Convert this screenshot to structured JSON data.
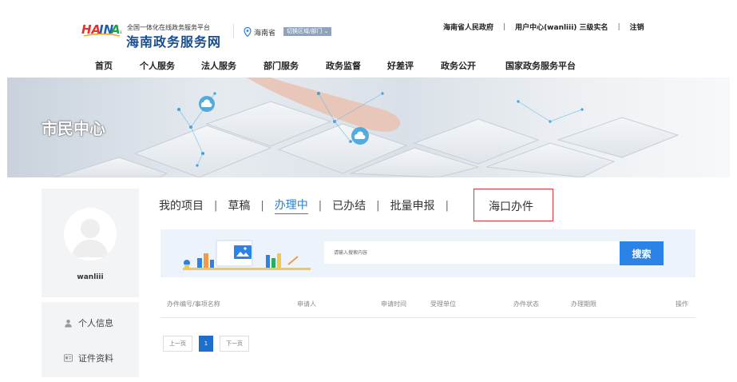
{
  "header": {
    "logo_text": "HAINAN",
    "platform_sub": "全国一体化在线政务服务平台",
    "site_title": "海南政务服务网",
    "location": "海南省",
    "region_select": "切换区域/部门",
    "top_links": [
      "海南省人民政府",
      "用户中心(wanliii) 三级实名",
      "注销"
    ]
  },
  "nav": [
    "首页",
    "个人服务",
    "法人服务",
    "部门服务",
    "政务监督",
    "好差评",
    "政务公开",
    "国家政务服务平台"
  ],
  "banner": {
    "title": "市民中心"
  },
  "sidebar": {
    "username": "wanliii",
    "menu": [
      "个人信息",
      "证件资料"
    ]
  },
  "tabs": [
    "我的项目",
    "草稿",
    "办理中",
    "已办结",
    "批量申报"
  ],
  "active_tab": "办理中",
  "highlighted_tab": "海口办件",
  "search": {
    "placeholder": "请输入搜索内容",
    "button": "搜索"
  },
  "table": {
    "columns": [
      "办件编号/事项名称",
      "申请人",
      "申请时间",
      "受理单位",
      "办件状态",
      "办理期限",
      "操作"
    ]
  },
  "pagination": {
    "prev": "上一页",
    "current": "1",
    "next": "下一页"
  },
  "colors": {
    "accent": "#2a7fd1",
    "search_button": "#2b83e6",
    "highlight_border": "#d9363e",
    "page_active": "#1e6fc9"
  }
}
